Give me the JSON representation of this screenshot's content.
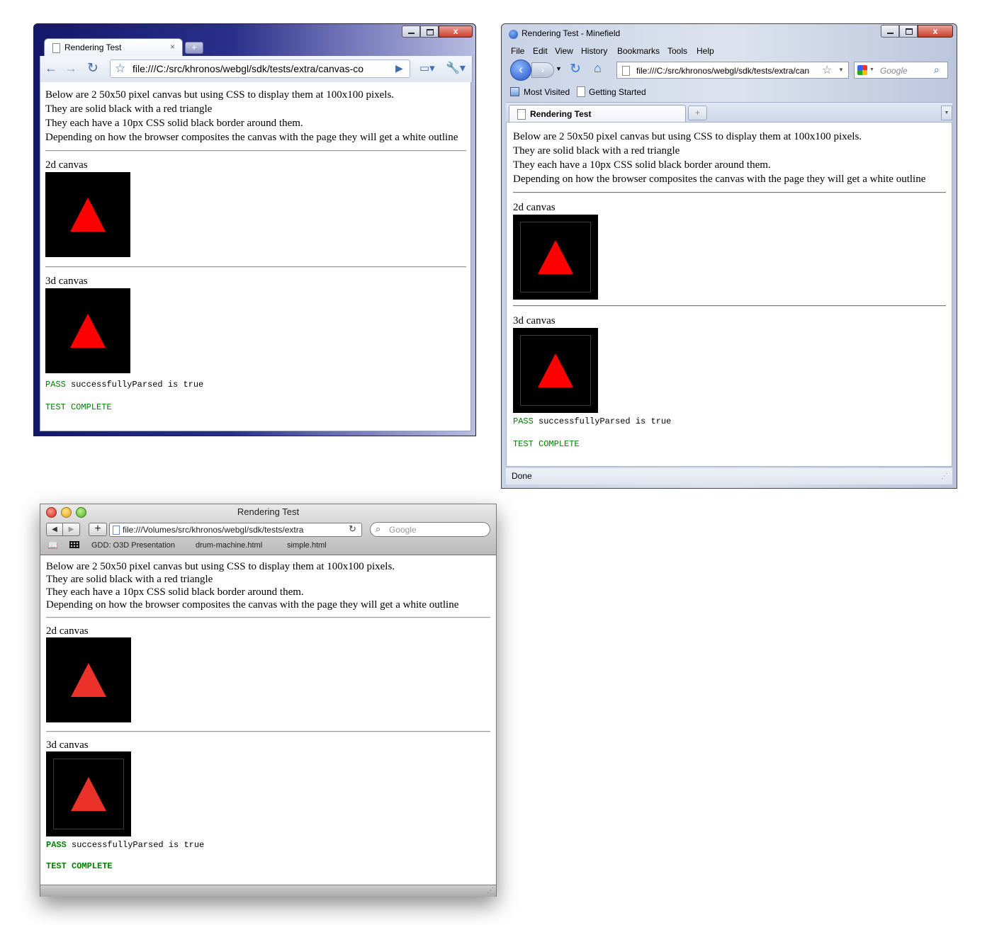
{
  "content": {
    "intro": [
      "Below are 2 50x50 pixel canvas but using CSS to display them at 100x100 pixels.",
      "They are solid black with a red triangle",
      "They each have a 10px CSS solid black border around them.",
      "Depending on how the browser composites the canvas with the page they will get a white outline"
    ],
    "canvas2d_label": "2d canvas",
    "canvas3d_label": "3d canvas",
    "pass_word": "PASS",
    "pass_text": "successfullyParsed is true",
    "complete_text": "TEST COMPLETE"
  },
  "chrome": {
    "tab_title": "Rendering Test",
    "url": "file:///C:/src/khronos/webgl/sdk/tests/extra/canvas-co"
  },
  "firefox": {
    "window_title": "Rendering Test - Minefield",
    "menu": [
      "File",
      "Edit",
      "View",
      "History",
      "Bookmarks",
      "Tools",
      "Help"
    ],
    "url": "file:///C:/src/khronos/webgl/sdk/tests/extra/can",
    "search_placeholder": "Google",
    "bookmarks": [
      "Most Visited",
      "Getting Started"
    ],
    "tab_title": "Rendering Test",
    "status": "Done"
  },
  "safari": {
    "window_title": "Rendering Test",
    "url": "file:///Volumes/src/khronos/webgl/sdk/tests/extra",
    "search_placeholder": "Google",
    "bookmarks": [
      "GDD: O3D Presentation",
      "drum-machine.html",
      "simple.html"
    ]
  },
  "colors": {
    "pass_green": "#008000",
    "triangle_red": "#ff0000",
    "safari_triangle": "#e8322a"
  }
}
